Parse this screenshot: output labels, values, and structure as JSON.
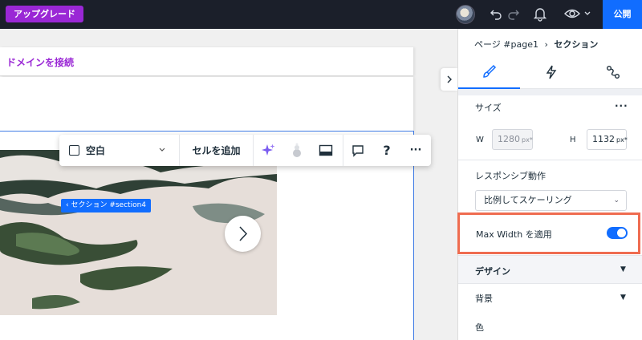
{
  "topbar": {
    "upgrade_label": "アップグレード",
    "publish_label": "公開",
    "icons": [
      "undo-icon",
      "redo-icon",
      "bell-icon",
      "eye-icon",
      "chevron-down-icon"
    ]
  },
  "canvas": {
    "domain_link": "ドメインを接続",
    "section_tag": "‹ セクション #section4",
    "toolbar": {
      "blank_label": "空白",
      "add_cell_label": "セルを追加",
      "help_label": "?",
      "more_label": "···"
    }
  },
  "panel": {
    "breadcrumb_page": "ページ #page1",
    "breadcrumb_sep": "›",
    "breadcrumb_current": "セクション",
    "size_title": "サイズ",
    "more_label": "···",
    "w_label": "W",
    "w_value": "1280",
    "w_unit": "px*",
    "h_label": "H",
    "h_value": "1132",
    "h_unit": "px*",
    "responsive_title": "レスポンシブ動作",
    "responsive_value": "比例してスケーリング",
    "max_width_label": "Max Width を適用",
    "max_width_enabled": true,
    "design_title": "デザイン",
    "background_title": "背景",
    "color_label": "色"
  },
  "colors": {
    "accent": "#116dff",
    "upgrade": "#9a27d5",
    "highlight": "#ef6c50",
    "topbar": "#1b1f2a"
  }
}
